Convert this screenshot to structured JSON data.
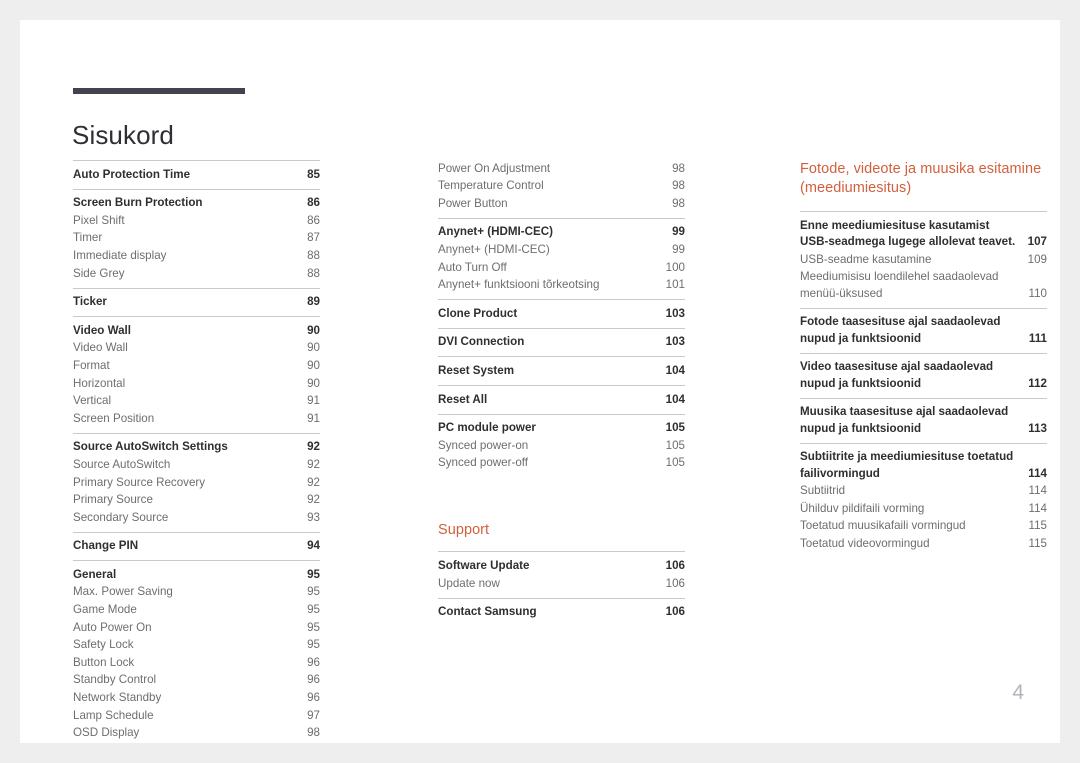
{
  "document": {
    "title": "Sisukord",
    "page_number": "4",
    "accent_color": "#d2603d",
    "rule_color": "#43424e",
    "heading_color": "#2f2f33",
    "subentry_color": "#6e6e72"
  },
  "columns": [
    {
      "id": "column-1",
      "blocks": [
        {
          "type": "group",
          "rule": true,
          "entries": [
            {
              "level": 1,
              "label": "Auto Protection Time",
              "page": "85"
            }
          ]
        },
        {
          "type": "group",
          "rule": true,
          "entries": [
            {
              "level": 1,
              "label": "Screen Burn Protection",
              "page": "86"
            },
            {
              "level": 2,
              "label": "Pixel Shift",
              "page": "86"
            },
            {
              "level": 2,
              "label": "Timer",
              "page": "87"
            },
            {
              "level": 2,
              "label": "Immediate display",
              "page": "88"
            },
            {
              "level": 2,
              "label": "Side Grey",
              "page": "88"
            }
          ]
        },
        {
          "type": "group",
          "rule": true,
          "entries": [
            {
              "level": 1,
              "label": "Ticker",
              "page": "89"
            }
          ]
        },
        {
          "type": "group",
          "rule": true,
          "entries": [
            {
              "level": 1,
              "label": "Video Wall",
              "page": "90"
            },
            {
              "level": 2,
              "label": "Video Wall",
              "page": "90"
            },
            {
              "level": 2,
              "label": "Format",
              "page": "90"
            },
            {
              "level": 2,
              "label": "Horizontal",
              "page": "90"
            },
            {
              "level": 2,
              "label": "Vertical",
              "page": "91"
            },
            {
              "level": 2,
              "label": "Screen Position",
              "page": "91"
            }
          ]
        },
        {
          "type": "group",
          "rule": true,
          "entries": [
            {
              "level": 1,
              "label": "Source AutoSwitch Settings",
              "page": "92"
            },
            {
              "level": 2,
              "label": "Source AutoSwitch",
              "page": "92"
            },
            {
              "level": 2,
              "label": "Primary Source Recovery",
              "page": "92"
            },
            {
              "level": 2,
              "label": "Primary Source",
              "page": "92"
            },
            {
              "level": 2,
              "label": "Secondary Source",
              "page": "93"
            }
          ]
        },
        {
          "type": "group",
          "rule": true,
          "entries": [
            {
              "level": 1,
              "label": "Change PIN",
              "page": "94"
            }
          ]
        },
        {
          "type": "group",
          "rule": true,
          "entries": [
            {
              "level": 1,
              "label": "General",
              "page": "95"
            },
            {
              "level": 2,
              "label": "Max. Power Saving",
              "page": "95"
            },
            {
              "level": 2,
              "label": "Game Mode",
              "page": "95"
            },
            {
              "level": 2,
              "label": "Auto Power On",
              "page": "95"
            },
            {
              "level": 2,
              "label": "Safety Lock",
              "page": "95"
            },
            {
              "level": 2,
              "label": "Button Lock",
              "page": "96"
            },
            {
              "level": 2,
              "label": "Standby Control",
              "page": "96"
            },
            {
              "level": 2,
              "label": "Network Standby",
              "page": "96"
            },
            {
              "level": 2,
              "label": "Lamp Schedule",
              "page": "97"
            },
            {
              "level": 2,
              "label": "OSD Display",
              "page": "98"
            }
          ]
        }
      ]
    },
    {
      "id": "column-2",
      "blocks": [
        {
          "type": "group",
          "rule": false,
          "entries": [
            {
              "level": 2,
              "label": "Power On Adjustment",
              "page": "98"
            },
            {
              "level": 2,
              "label": "Temperature Control",
              "page": "98"
            },
            {
              "level": 2,
              "label": "Power Button",
              "page": "98"
            }
          ]
        },
        {
          "type": "group",
          "rule": true,
          "entries": [
            {
              "level": 1,
              "label": "Anynet+ (HDMI-CEC)",
              "page": "99"
            },
            {
              "level": 2,
              "label": "Anynet+ (HDMI-CEC)",
              "page": "99"
            },
            {
              "level": 2,
              "label": "Auto Turn Off",
              "page": "100"
            },
            {
              "level": 2,
              "label": "Anynet+ funktsiooni tõrkeotsing",
              "page": "101"
            }
          ]
        },
        {
          "type": "group",
          "rule": true,
          "entries": [
            {
              "level": 1,
              "label": "Clone Product",
              "page": "103"
            }
          ]
        },
        {
          "type": "group",
          "rule": true,
          "entries": [
            {
              "level": 1,
              "label": "DVI Connection",
              "page": "103"
            }
          ]
        },
        {
          "type": "group",
          "rule": true,
          "entries": [
            {
              "level": 1,
              "label": "Reset System",
              "page": "104"
            }
          ]
        },
        {
          "type": "group",
          "rule": true,
          "entries": [
            {
              "level": 1,
              "label": "Reset All",
              "page": "104"
            }
          ]
        },
        {
          "type": "group",
          "rule": true,
          "entries": [
            {
              "level": 1,
              "label": "PC module power",
              "page": "105"
            },
            {
              "level": 2,
              "label": "Synced power-on",
              "page": "105"
            },
            {
              "level": 2,
              "label": "Synced power-off",
              "page": "105"
            }
          ]
        },
        {
          "type": "spacer"
        },
        {
          "type": "section",
          "label": "Support"
        },
        {
          "type": "group",
          "rule": true,
          "entries": [
            {
              "level": 1,
              "label": "Software Update",
              "page": "106"
            },
            {
              "level": 2,
              "label": "Update now",
              "page": "106"
            }
          ]
        },
        {
          "type": "group",
          "rule": true,
          "entries": [
            {
              "level": 1,
              "label": "Contact Samsung",
              "page": "106"
            }
          ]
        }
      ]
    },
    {
      "id": "column-3",
      "blocks": [
        {
          "type": "section",
          "label": "Fotode, videote ja muusika esitamine (meediumiesitus)",
          "tall": true
        },
        {
          "type": "group",
          "rule": true,
          "entries": [
            {
              "level": 1,
              "label": "Enne meediumiesituse kasutamist USB-seadmega lugege allolevat teavet.",
              "page": "107",
              "wrap": true
            },
            {
              "level": 2,
              "label": "USB-seadme kasutamine",
              "page": "109"
            },
            {
              "level": 2,
              "label": "Meediumisisu loendilehel saadaolevad menüü-üksused",
              "page": "110",
              "wrap": true
            }
          ]
        },
        {
          "type": "group",
          "rule": true,
          "entries": [
            {
              "level": 1,
              "label": "Fotode taasesituse ajal saadaolevad nupud ja funktsioonid",
              "page": "111",
              "wrap": true
            }
          ]
        },
        {
          "type": "group",
          "rule": true,
          "entries": [
            {
              "level": 1,
              "label": "Video taasesituse ajal saadaolevad nupud ja funktsioonid",
              "page": "112",
              "wrap": true
            }
          ]
        },
        {
          "type": "group",
          "rule": true,
          "entries": [
            {
              "level": 1,
              "label": "Muusika taasesituse ajal saadaolevad nupud ja funktsioonid",
              "page": "113",
              "wrap": true
            }
          ]
        },
        {
          "type": "group",
          "rule": true,
          "entries": [
            {
              "level": 1,
              "label": "Subtiitrite ja meediumiesituse toetatud failivormingud",
              "page": "114",
              "wrap": true
            },
            {
              "level": 2,
              "label": "Subtiitrid",
              "page": "114"
            },
            {
              "level": 2,
              "label": "Ühilduv pildifaili vorming",
              "page": "114"
            },
            {
              "level": 2,
              "label": "Toetatud muusikafaili vormingud",
              "page": "115"
            },
            {
              "level": 2,
              "label": "Toetatud videovormingud",
              "page": "115"
            }
          ]
        }
      ]
    }
  ]
}
